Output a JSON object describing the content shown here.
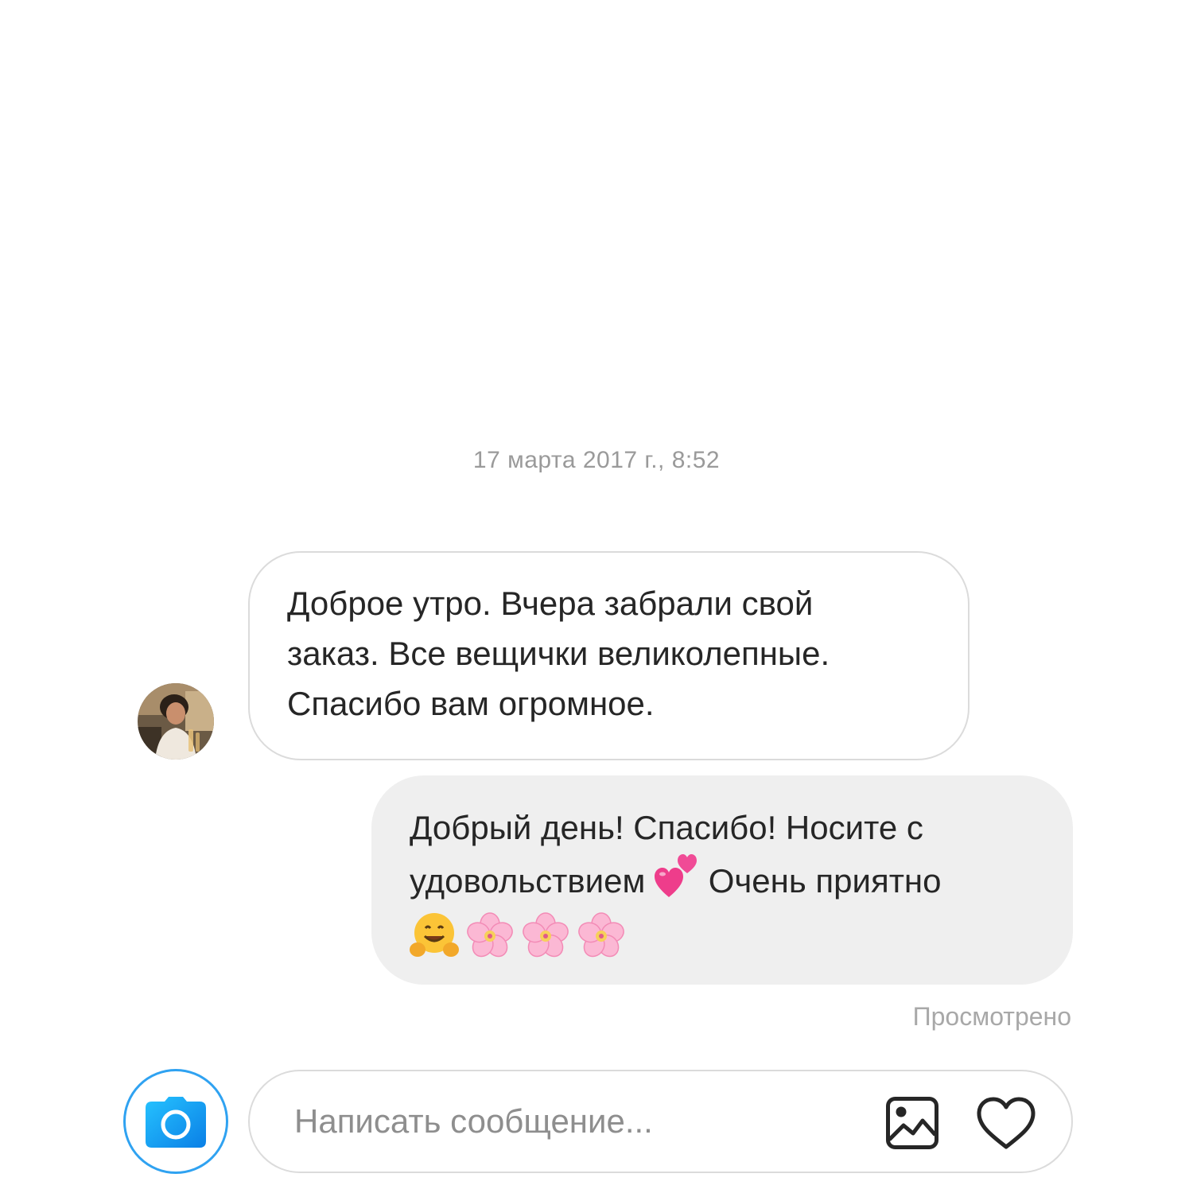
{
  "thread": {
    "timestamp": "17 марта 2017 г., 8:52",
    "messages": [
      {
        "direction": "incoming",
        "lines": [
          "Доброе утро. Вчера забрали свой",
          "заказ. Все вещички великолепные.",
          "Спасибо вам огромное."
        ]
      },
      {
        "direction": "outgoing",
        "lines": [
          "Добрый день! Спасибо! Носите с",
          "удовольствием",
          "Очень приятно"
        ],
        "emojis": [
          "two-hearts-icon",
          "hugging-face-icon",
          "cherry-blossom-icon",
          "cherry-blossom-icon",
          "cherry-blossom-icon"
        ]
      }
    ],
    "seen_status": "Просмотрено"
  },
  "composer": {
    "placeholder": "Написать сообщение...",
    "value": ""
  },
  "colors": {
    "accent": "#0095f6",
    "incoming_border": "#dbdbdb",
    "outgoing_bg": "#efefef",
    "text": "#262626",
    "muted": "#9a9a9a"
  }
}
